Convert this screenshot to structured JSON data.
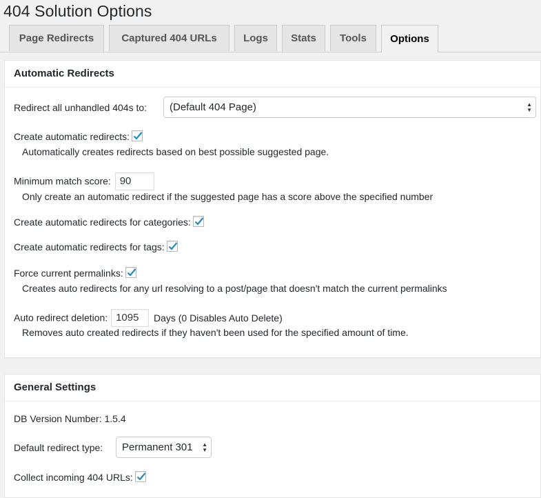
{
  "page": {
    "title": "404 Solution Options"
  },
  "tabs": [
    {
      "label": "Page Redirects"
    },
    {
      "label": "Captured 404 URLs"
    },
    {
      "label": "Logs"
    },
    {
      "label": "Stats"
    },
    {
      "label": "Tools"
    },
    {
      "label": "Options",
      "active": true
    }
  ],
  "auto": {
    "heading": "Automatic Redirects",
    "redirect_all_label": "Redirect all unhandled 404s to:",
    "redirect_all_value": "(Default 404 Page)",
    "create_auto_label": "Create automatic redirects:",
    "create_auto_checked": true,
    "create_auto_desc": "Automatically creates redirects based on best possible suggested page.",
    "min_score_label": "Minimum match score:",
    "min_score_value": "90",
    "min_score_desc": "Only create an automatic redirect if the suggested page has a score above the specified number",
    "categories_label": "Create automatic redirects for categories:",
    "categories_checked": true,
    "tags_label": "Create automatic redirects for tags:",
    "tags_checked": true,
    "force_label": "Force current permalinks:",
    "force_checked": true,
    "force_desc": "Creates auto redirects for any url resolving to a post/page that doesn't match the current permalinks",
    "deletion_label": "Auto redirect deletion:",
    "deletion_value": "1095",
    "deletion_suffix": "Days (0 Disables Auto Delete)",
    "deletion_desc": "Removes auto created redirects if they haven't been used for the specified amount of time."
  },
  "general": {
    "heading": "General Settings",
    "db_version": "DB Version Number: 1.5.4",
    "redirect_type_label": "Default redirect type:",
    "redirect_type_value": "Permanent 301",
    "collect_label": "Collect incoming 404 URLs:",
    "collect_checked": true
  },
  "colors": {
    "check": "#1e8cbe",
    "tab_bg": "#e5e5e5",
    "page_bg": "#f1f1f1"
  }
}
